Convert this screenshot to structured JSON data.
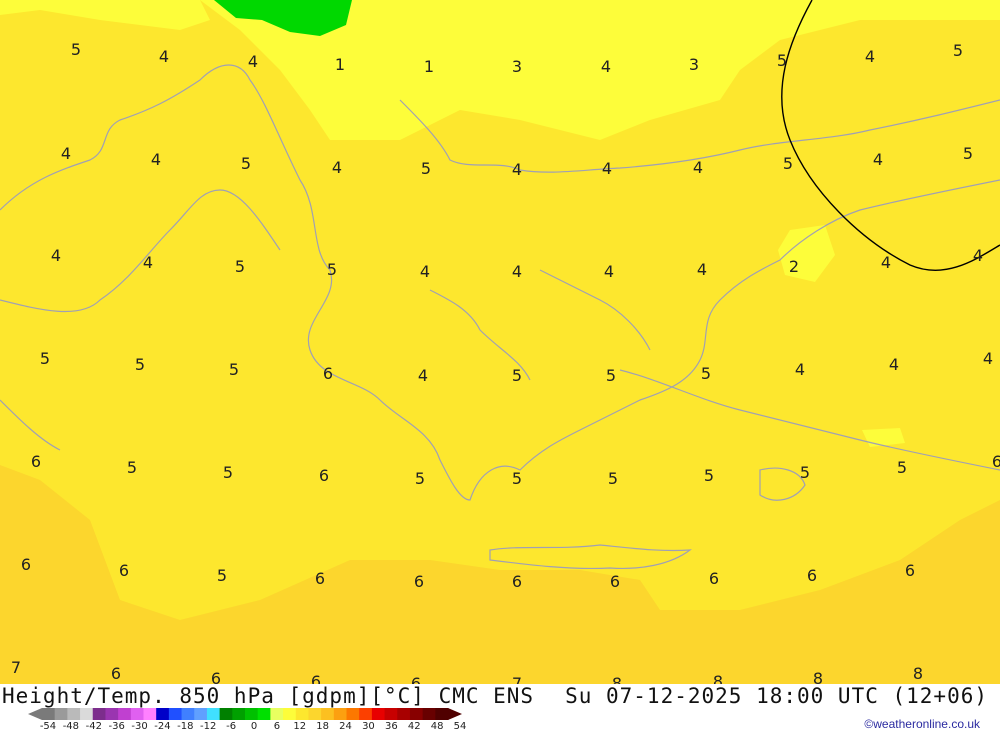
{
  "title": "Height/Temp. 850 hPa [gdpm][°C] CMC ENS",
  "datetime": "Su 07-12-2025 18:00 UTC (12+06)",
  "credit": "©weatheronline.co.uk",
  "colors": {
    "yellow_main": "#fde72e",
    "yellow_light": "#fdfd3a",
    "orange_light": "#fcd62d",
    "green": "#00d800",
    "coastline": "#a0a0b4",
    "contour": "#000000"
  },
  "map_labels": [
    "5",
    "4",
    "4",
    "1",
    "1",
    "3",
    "4",
    "3",
    "5",
    "4",
    "5",
    "4",
    "4",
    "5",
    "4",
    "5",
    "4",
    "4",
    "4",
    "5",
    "4",
    "5",
    "4",
    "4",
    "5",
    "5",
    "4",
    "4",
    "4",
    "4",
    "2",
    "4",
    "4",
    "5",
    "5",
    "5",
    "6",
    "4",
    "5",
    "5",
    "5",
    "4",
    "4",
    "4",
    "6",
    "5",
    "5",
    "6",
    "5",
    "5",
    "5",
    "5",
    "5",
    "5",
    "6",
    "6",
    "6",
    "5",
    "6",
    "6",
    "6",
    "6",
    "6",
    "6",
    "6",
    "7",
    "6",
    "6",
    "6",
    "6",
    "7",
    "8",
    "8",
    "8",
    "8"
  ],
  "legend": {
    "ticks": [
      "-54",
      "-48",
      "-42",
      "-36",
      "-30",
      "-24",
      "-18",
      "-12",
      "-6",
      "0",
      "6",
      "12",
      "18",
      "24",
      "30",
      "36",
      "42",
      "48",
      "54"
    ],
    "colors": [
      "#7a7a7a",
      "#9a9a9a",
      "#bababa",
      "#dadada",
      "#7c2d8c",
      "#9a35b0",
      "#c040d0",
      "#e060f0",
      "#ff80ff",
      "#0000c8",
      "#2050ff",
      "#4080ff",
      "#60a0ff",
      "#40e0ff",
      "#008000",
      "#00a000",
      "#00c000",
      "#00e000",
      "#e8ff60",
      "#fdfd3a",
      "#fde72e",
      "#fcd62d",
      "#fcc020",
      "#fca010",
      "#fc7800",
      "#fc4000",
      "#e80000",
      "#c80000",
      "#a80000",
      "#880000",
      "#680000",
      "#500000"
    ]
  }
}
